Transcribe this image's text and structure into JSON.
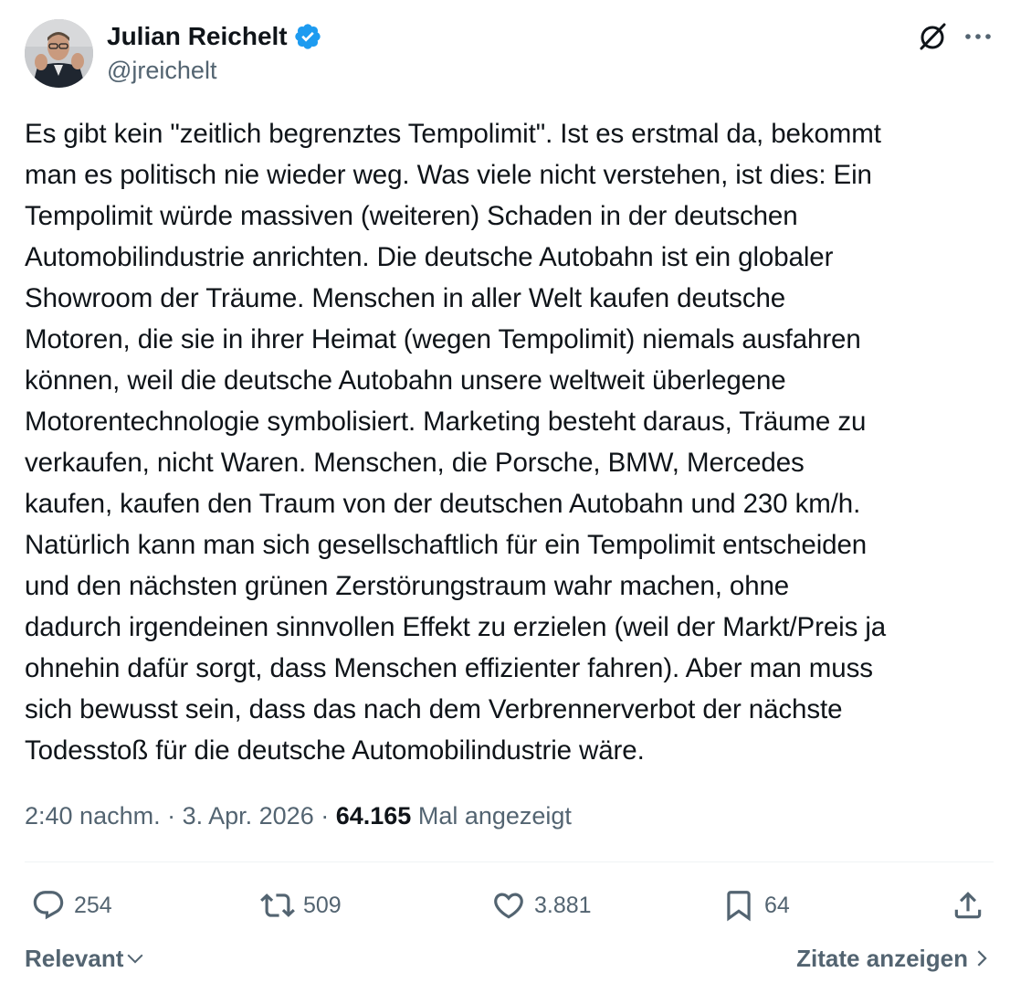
{
  "author": {
    "name": "Julian Reichelt",
    "handle": "@jreichelt",
    "verified_color": "#1d9bf0"
  },
  "header_icons": [
    "grok-icon",
    "more-icon"
  ],
  "tweet": {
    "text": "Es gibt kein \"zeitlich begrenztes Tempolimit\". Ist es erstmal da, bekommt\nman es politisch nie wieder weg. Was viele nicht verstehen, ist dies: Ein\nTempolimit würde massiven (weiteren) Schaden in der deutschen\nAutomobilindustrie anrichten. Die deutsche Autobahn ist ein globaler\nShowroom der Träume. Menschen in aller Welt kaufen deutsche\nMotoren, die sie in ihrer Heimat (wegen Tempolimit) niemals ausfahren\nkönnen, weil die deutsche Autobahn unsere weltweit überlegene\nMotorentechnologie symbolisiert. Marketing besteht daraus, Träume zu\nverkaufen, nicht Waren. Menschen, die Porsche, BMW, Mercedes\nkaufen, kaufen den Traum von der deutschen Autobahn und 230 km/h.\nNatürlich kann man sich gesellschaftlich für ein Tempolimit entscheiden\nund den nächsten grünen Zerstörungstraum wahr machen, ohne\ndadurch irgendeinen sinnvollen Effekt zu erzielen (weil der Markt/Preis ja\nohnehin dafür sorgt, dass Menschen effizienter fahren). Aber man muss\nsich bewusst sein, dass das nach dem Verbrennerverbot der nächste\nTodesstoß für die deutsche Automobilindustrie wäre.",
    "time": "2:40 nachm.",
    "separator": " · ",
    "date": "3. Apr. 2026",
    "views_count": "64.165",
    "views_label": "Mal angezeigt"
  },
  "actions": {
    "replies": "254",
    "reposts": "509",
    "likes": "3.881",
    "bookmarks": "64"
  },
  "footer": {
    "sort_label": "Relevant",
    "quotes_label": "Zitate anzeigen"
  }
}
